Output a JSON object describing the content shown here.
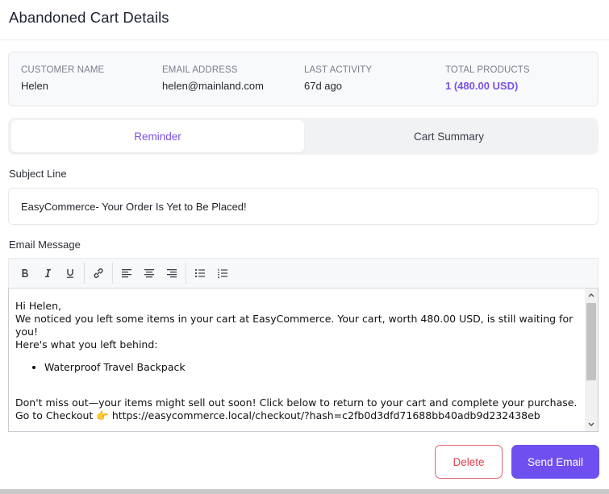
{
  "header": {
    "title": "Abandoned Cart Details"
  },
  "info": {
    "customer_name_label": "CUSTOMER NAME",
    "customer_name": "Helen",
    "email_label": "EMAIL ADDRESS",
    "email": "helen@mainland.com",
    "last_activity_label": "LAST ACTIVITY",
    "last_activity": "67d ago",
    "total_products_label": "TOTAL PRODUCTS",
    "total_products": "1 (480.00 USD)"
  },
  "tabs": [
    {
      "label": "Reminder",
      "active": true
    },
    {
      "label": "Cart Summary",
      "active": false
    }
  ],
  "subject": {
    "label": "Subject Line",
    "value": "EasyCommerce- Your Order Is Yet to Be Placed!"
  },
  "message": {
    "label": "Email Message",
    "toolbar": [
      "bold-icon",
      "italic-icon",
      "underline-icon",
      "link-icon",
      "align-left-icon",
      "align-center-icon",
      "align-right-icon",
      "bullet-list-icon",
      "numbered-list-icon"
    ],
    "greeting": "Hi Helen,",
    "line1": "We noticed you left some items in your cart at EasyCommerce. Your cart, worth 480.00 USD, is still waiting for you!",
    "line2": "Here's what you left behind:",
    "items": [
      "Waterproof Travel Backpack"
    ],
    "line3": "Don't miss out—your items might sell out soon! Click below to return to your cart and complete your purchase.",
    "checkout_prefix": "Go to Checkout 👉 ",
    "checkout_link": "https://easycommerce.local/checkout/?hash=c2fb0d3dfd71688bb40adb9d232438eb"
  },
  "actions": {
    "delete_label": "Delete",
    "send_label": "Send Email"
  },
  "colors": {
    "accent": "#7b52e6",
    "primary_button": "#6e4ff0",
    "danger": "#e0404f"
  }
}
